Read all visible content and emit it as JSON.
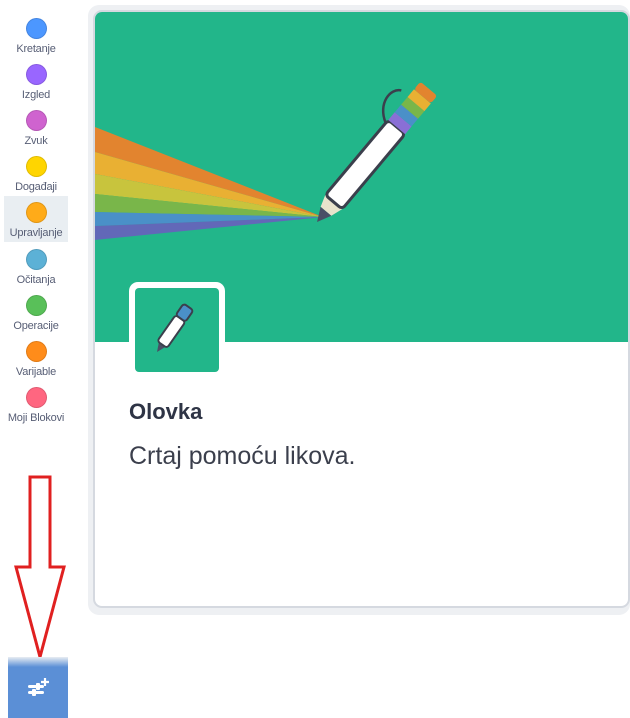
{
  "sidebar": {
    "categories": [
      {
        "label": "Kretanje",
        "color": "#4c97ff"
      },
      {
        "label": "Izgled",
        "color": "#9966ff"
      },
      {
        "label": "Zvuk",
        "color": "#cf63cf"
      },
      {
        "label": "Događaji",
        "color": "#ffd500"
      },
      {
        "label": "Upravljanje",
        "color": "#ffab19"
      },
      {
        "label": "Očitanja",
        "color": "#5cb1d6"
      },
      {
        "label": "Operacije",
        "color": "#59c059"
      },
      {
        "label": "Varijable",
        "color": "#ff8c1a"
      },
      {
        "label": "Moji Blokovi",
        "color": "#ff6680"
      }
    ],
    "selected": "Upravljanje",
    "extension_button_icon": "add-extension-icon"
  },
  "annotation": {
    "arrow_color": "#e02020",
    "arrow_icon": "down-arrow-icon"
  },
  "card": {
    "title": "Olovka",
    "description": "Crtaj pomoću likova.",
    "banner_color": "#22b68a",
    "banner_icon": "pen-rainbow-icon",
    "thumbnail_icon": "pen-icon"
  }
}
